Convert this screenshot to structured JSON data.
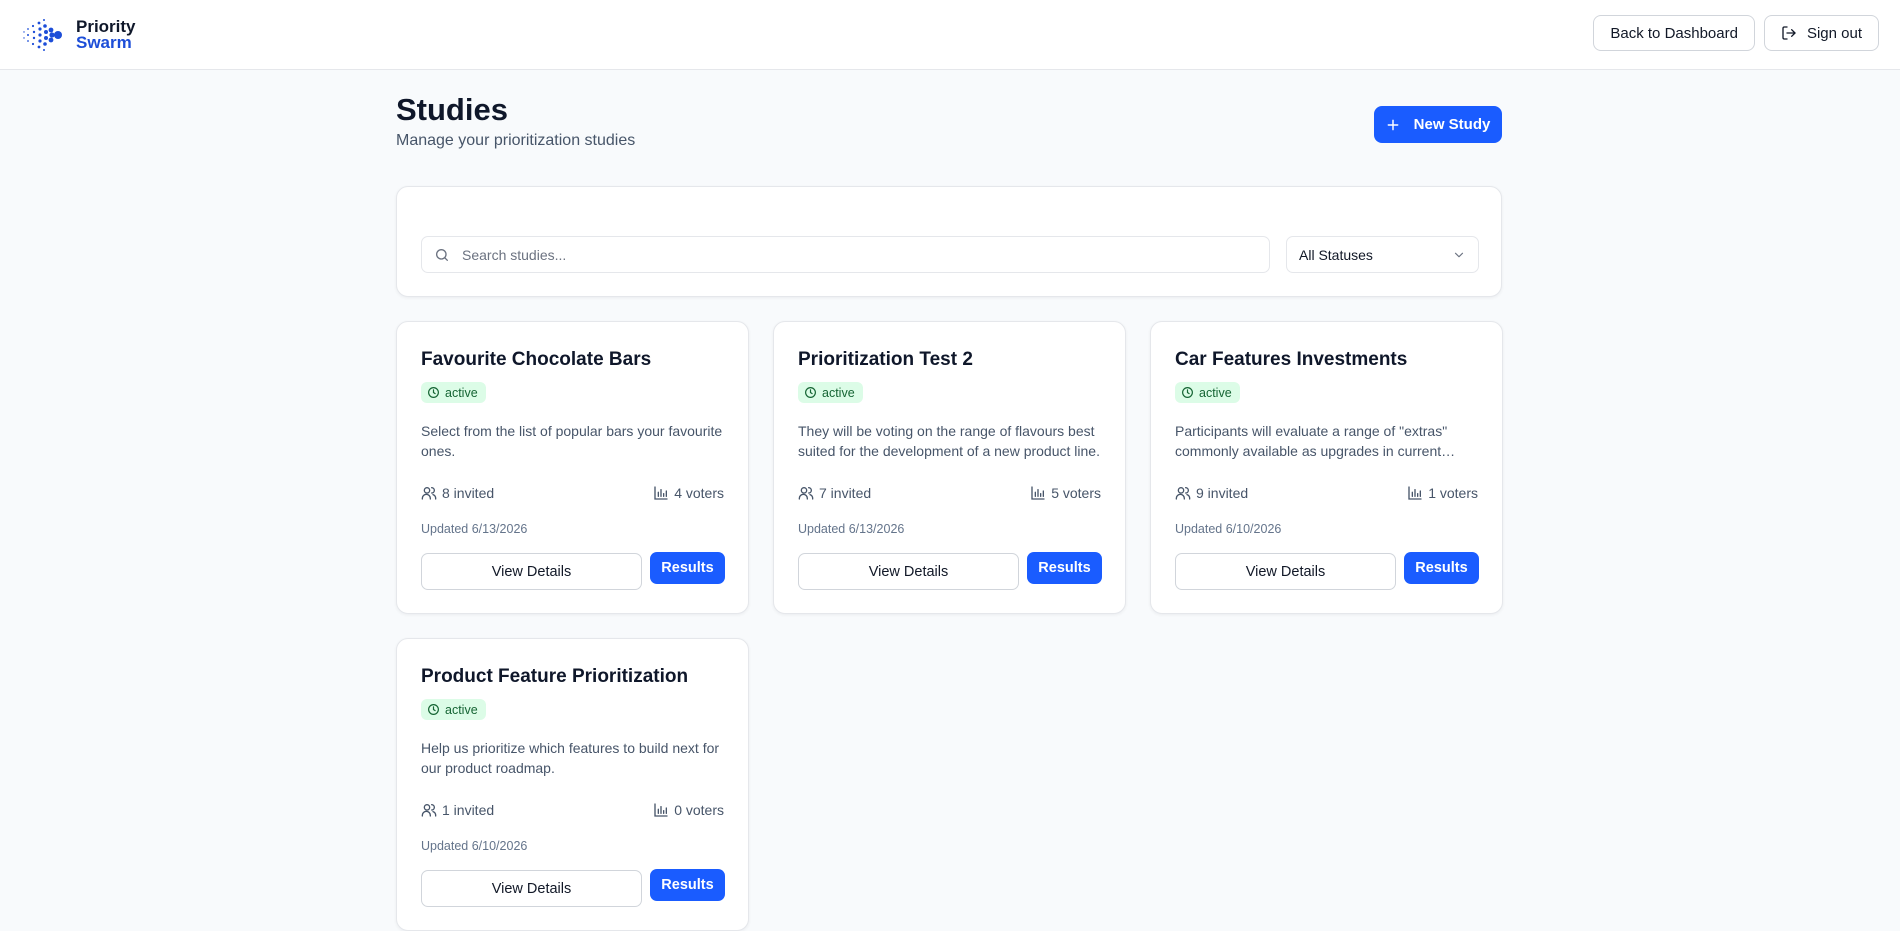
{
  "header": {
    "logo_line1": "Priority",
    "logo_line2": "Swarm",
    "back_label": "Back to Dashboard",
    "signout_label": "Sign out"
  },
  "page": {
    "title": "Studies",
    "subtitle": "Manage your prioritization studies",
    "new_study_label": "New Study"
  },
  "filters": {
    "search_placeholder": "Search studies...",
    "status_selected": "All Statuses"
  },
  "studies": [
    {
      "title": "Favourite Chocolate Bars",
      "status": "active",
      "description": "Select from the list of popular bars your favourite ones.",
      "invited": "8 invited",
      "voters": "4 voters",
      "updated": "Updated 6/13/2026",
      "details_label": "View Details",
      "results_label": "Results"
    },
    {
      "title": "Prioritization Test 2",
      "status": "active",
      "description": "They will be voting on the range of flavours best suited for the development of a new product line.",
      "invited": "7 invited",
      "voters": "5 voters",
      "updated": "Updated 6/13/2026",
      "details_label": "View Details",
      "results_label": "Results"
    },
    {
      "title": "Car Features Investments",
      "status": "active",
      "description": "Participants will evaluate a range of \"extras\" commonly available as upgrades in current models.",
      "invited": "9 invited",
      "voters": "1 voters",
      "updated": "Updated 6/10/2026",
      "details_label": "View Details",
      "results_label": "Results"
    },
    {
      "title": "Product Feature Prioritization",
      "status": "active",
      "description": "Help us prioritize which features to build next for our product roadmap.",
      "invited": "1 invited",
      "voters": "0 voters",
      "updated": "Updated 6/10/2026",
      "details_label": "View Details",
      "results_label": "Results"
    }
  ],
  "colors": {
    "primary": "#1a5cff",
    "badge_bg": "#dcfce7",
    "badge_text": "#166534"
  }
}
